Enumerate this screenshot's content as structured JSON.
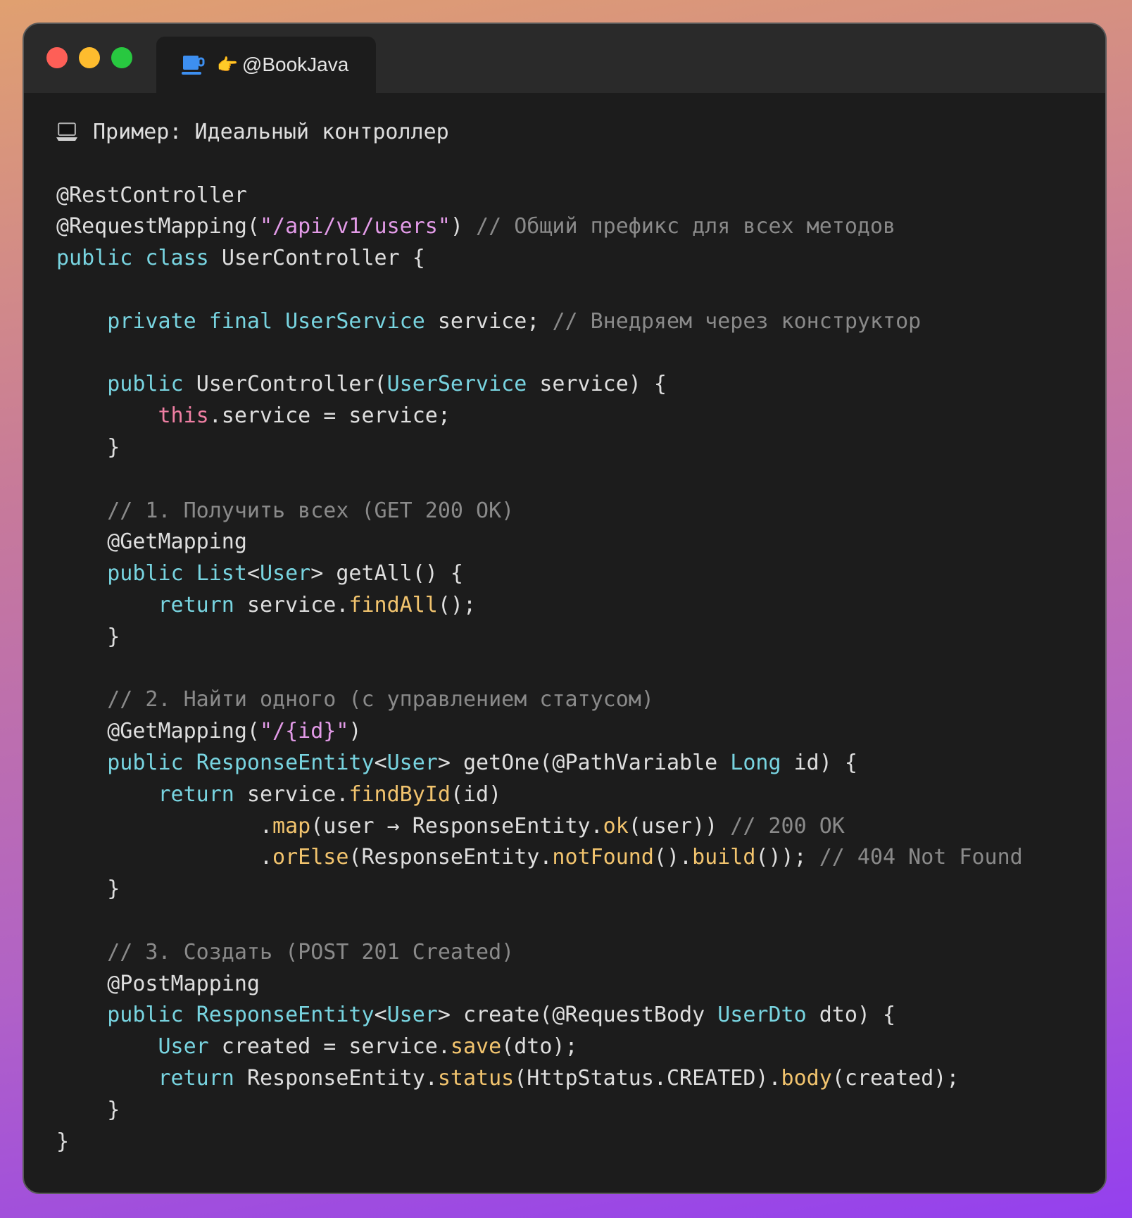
{
  "window": {
    "tab_title": "@BookJava",
    "tab_icon": "coffee-cup-icon",
    "tab_hand_icon": "pointing-hand-icon",
    "hand_glyph": "👉"
  },
  "code": {
    "heading": "Пример: Идеальный контроллер",
    "lines": [
      [
        [
          "cm",
          "laptop"
        ],
        [
          "pl",
          "Пример: Идеальный контроллер"
        ]
      ],
      [],
      [
        [
          "pl",
          "@RestController"
        ]
      ],
      [
        [
          "pl",
          "@RequestMapping("
        ],
        [
          "str",
          "\"/api/v1/users\""
        ],
        [
          "pl",
          ") "
        ],
        [
          "cm",
          "// Общий префикс для всех методов"
        ]
      ],
      [
        [
          "kw",
          "public class "
        ],
        [
          "pl",
          "UserController {"
        ]
      ],
      [],
      [
        [
          "pl",
          "    "
        ],
        [
          "kw",
          "private final "
        ],
        [
          "ty",
          "UserService"
        ],
        [
          "pl",
          " service; "
        ],
        [
          "cm",
          "// Внедряем через конструктор"
        ]
      ],
      [],
      [
        [
          "pl",
          "    "
        ],
        [
          "kw",
          "public "
        ],
        [
          "pl",
          "UserController("
        ],
        [
          "ty",
          "UserService"
        ],
        [
          "pl",
          " service) {"
        ]
      ],
      [
        [
          "pl",
          "        "
        ],
        [
          "th",
          "this"
        ],
        [
          "pl",
          ".service = service;"
        ]
      ],
      [
        [
          "pl",
          "    }"
        ]
      ],
      [],
      [
        [
          "pl",
          "    "
        ],
        [
          "cm",
          "// 1. Получить всех (GET 200 OK)"
        ]
      ],
      [
        [
          "pl",
          "    @GetMapping"
        ]
      ],
      [
        [
          "pl",
          "    "
        ],
        [
          "kw",
          "public "
        ],
        [
          "ty",
          "List"
        ],
        [
          "pl",
          "<"
        ],
        [
          "ty",
          "User"
        ],
        [
          "pl",
          "> getAll() {"
        ]
      ],
      [
        [
          "pl",
          "        "
        ],
        [
          "kw",
          "return "
        ],
        [
          "pl",
          "service."
        ],
        [
          "fn",
          "findAll"
        ],
        [
          "pl",
          "();"
        ]
      ],
      [
        [
          "pl",
          "    }"
        ]
      ],
      [],
      [
        [
          "pl",
          "    "
        ],
        [
          "cm",
          "// 2. Найти одного (с управлением статусом)"
        ]
      ],
      [
        [
          "pl",
          "    @GetMapping("
        ],
        [
          "str",
          "\"/{id}\""
        ],
        [
          "pl",
          ")"
        ]
      ],
      [
        [
          "pl",
          "    "
        ],
        [
          "kw",
          "public "
        ],
        [
          "ty",
          "ResponseEntity"
        ],
        [
          "pl",
          "<"
        ],
        [
          "ty",
          "User"
        ],
        [
          "pl",
          "> getOne(@PathVariable "
        ],
        [
          "ty",
          "Long"
        ],
        [
          "pl",
          " id) {"
        ]
      ],
      [
        [
          "pl",
          "        "
        ],
        [
          "kw",
          "return "
        ],
        [
          "pl",
          "service."
        ],
        [
          "fn",
          "findById"
        ],
        [
          "pl",
          "(id)"
        ]
      ],
      [
        [
          "pl",
          "                ."
        ],
        [
          "fn",
          "map"
        ],
        [
          "pl",
          "(user → ResponseEntity."
        ],
        [
          "fn",
          "ok"
        ],
        [
          "pl",
          "(user)) "
        ],
        [
          "cm",
          "// 200 OK"
        ]
      ],
      [
        [
          "pl",
          "                ."
        ],
        [
          "fn",
          "orElse"
        ],
        [
          "pl",
          "(ResponseEntity."
        ],
        [
          "fn",
          "notFound"
        ],
        [
          "pl",
          "()."
        ],
        [
          "fn",
          "build"
        ],
        [
          "pl",
          "()); "
        ],
        [
          "cm",
          "// 404 Not Found"
        ]
      ],
      [
        [
          "pl",
          "    }"
        ]
      ],
      [],
      [
        [
          "pl",
          "    "
        ],
        [
          "cm",
          "// 3. Создать (POST 201 Created)"
        ]
      ],
      [
        [
          "pl",
          "    @PostMapping"
        ]
      ],
      [
        [
          "pl",
          "    "
        ],
        [
          "kw",
          "public "
        ],
        [
          "ty",
          "ResponseEntity"
        ],
        [
          "pl",
          "<"
        ],
        [
          "ty",
          "User"
        ],
        [
          "pl",
          "> create(@RequestBody "
        ],
        [
          "ty",
          "UserDto"
        ],
        [
          "pl",
          " dto) {"
        ]
      ],
      [
        [
          "pl",
          "        "
        ],
        [
          "ty",
          "User"
        ],
        [
          "pl",
          " created = service."
        ],
        [
          "fn",
          "save"
        ],
        [
          "pl",
          "(dto);"
        ]
      ],
      [
        [
          "pl",
          "        "
        ],
        [
          "kw",
          "return "
        ],
        [
          "pl",
          "ResponseEntity."
        ],
        [
          "fn",
          "status"
        ],
        [
          "pl",
          "(HttpStatus.CREATED)."
        ],
        [
          "fn",
          "body"
        ],
        [
          "pl",
          "(created);"
        ]
      ],
      [
        [
          "pl",
          "    }"
        ]
      ],
      [
        [
          "pl",
          "}"
        ]
      ]
    ]
  },
  "colors": {
    "close": "#fe5f57",
    "minimize": "#febc2e",
    "maximize": "#28c840",
    "keyword": "#78d4e0",
    "string": "#e39be8",
    "comment": "#8a8a8a",
    "method": "#f2c46e",
    "this": "#ef7fa3"
  }
}
